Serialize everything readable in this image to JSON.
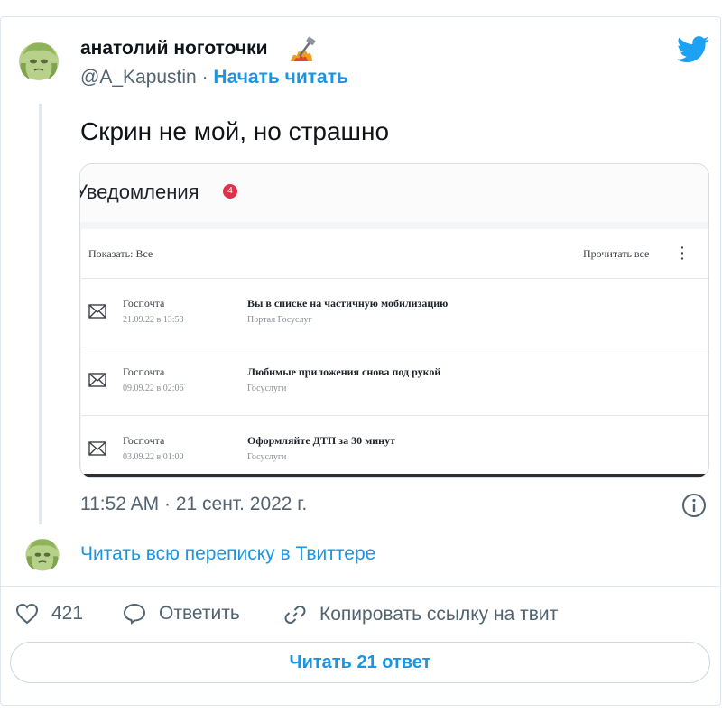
{
  "author": {
    "name": "анатолий ноготочки",
    "handle": "@A_Kapustin",
    "separator": "·",
    "follow_label": "Начать читать"
  },
  "tweet": {
    "text": "Скрин не мой, но страшно",
    "timestamp": "11:52 AM · 21 сент. 2022 г."
  },
  "screenshot": {
    "title": "Уведомления",
    "badge_count": "4",
    "filter_label": "Показать: Все",
    "read_all_label": "Прочитать все",
    "notifications": [
      {
        "sender": "Госпочта",
        "date": "21.09.22 в 13:58",
        "subject": "Вы в списке на частичную мобилизацию",
        "source": "Портал Госуслуг"
      },
      {
        "sender": "Госпочта",
        "date": "09.09.22 в 02:06",
        "subject": "Любимые приложения снова под рукой",
        "source": "Госуслуги"
      },
      {
        "sender": "Госпочта",
        "date": "03.09.22 в 01:00",
        "subject": "Оформляйте ДТП за 30 минут",
        "source": "Госуслуги"
      }
    ]
  },
  "thread": {
    "read_thread_label": "Читать всю переписку в Твиттере"
  },
  "actions": {
    "likes": "421",
    "reply_label": "Ответить",
    "copy_link_label": "Копировать ссылку на твит"
  },
  "replies_button": "Читать 21 ответ",
  "colors": {
    "link_blue": "#1b95e0",
    "muted": "#536471",
    "badge_red": "#e0304a"
  },
  "icons": [
    "avatar-cabbage",
    "hammer-fire-emoji",
    "twitter-bird-icon",
    "envelope-icon",
    "info-icon",
    "heart-icon",
    "reply-bubble-icon",
    "link-icon",
    "kebab-menu-icon"
  ]
}
